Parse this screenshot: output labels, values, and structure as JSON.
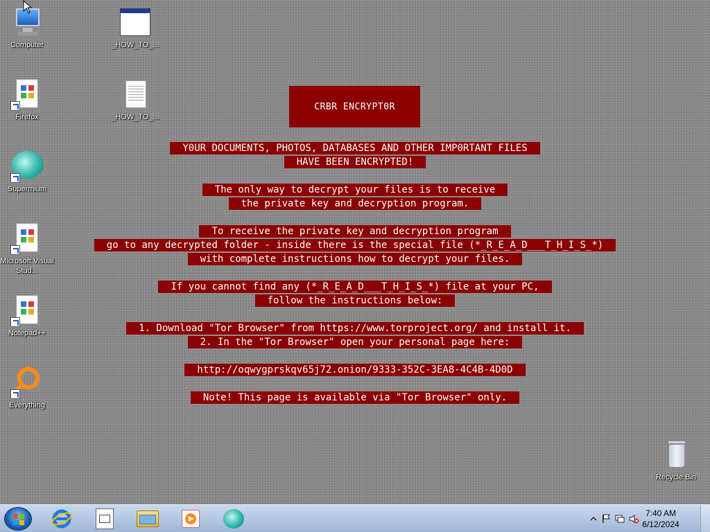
{
  "desktop": {
    "icons": [
      {
        "label": "Computer"
      },
      {
        "label": "_HOW_TO_..."
      },
      {
        "label": "Firefox"
      },
      {
        "label": "_HOW_TO_..."
      },
      {
        "label": "Supermium"
      },
      {
        "label": "Microsoft Visual Stud..."
      },
      {
        "label": "Notepad++"
      },
      {
        "label": "Everything"
      },
      {
        "label": "Recycle Bin"
      }
    ]
  },
  "ransom_note": {
    "title": "CRBR ENCRYPT0R",
    "lines": [
      "Y0UR DOCUMENTS, PHOTOS, DATABASES AND OTHER IMP0RTANT FILES",
      "HAVE BEEN ENCRYPTED!",
      "The only way to decrypt your files is to receive",
      "the private key and decryption program.",
      "To receive the private key and decryption program",
      "go to any decrypted folder - inside there is the special file (*_R_E_A_D___T_H_I_S_*)",
      "with complete instructions how to decrypt your files.",
      "If you cannot find any (*_R_E_A_D___T_H_I_S_*) file at your PC,",
      "follow the instructions below:",
      "1. Download \"Tor Browser\" from https://www.torproject.org/ and install it.",
      "2. In the \"Tor Browser\" open your personal page here:",
      "http://oqwygprskqv65j72.onion/9333-352C-3EA8-4C4B-4D0D",
      "Note! This page is available via \"Tor Browser\" only."
    ]
  },
  "taskbar": {
    "clock_time": "7:40 AM",
    "clock_date": "6/12/2024"
  },
  "colors": {
    "note_bg": "#8b0000"
  }
}
